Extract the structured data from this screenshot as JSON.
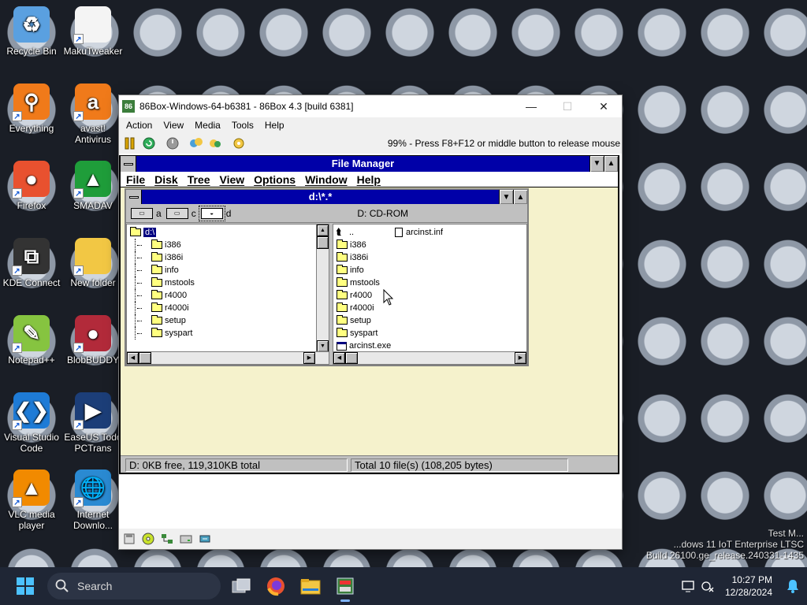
{
  "desktop": {
    "icons": [
      {
        "label": "Recycle Bin",
        "glyph": "♻",
        "color": "#5aa0e0"
      },
      {
        "label": "MakuTweaker",
        "glyph": "",
        "color": "#f4f4f4"
      },
      {
        "label": "Everything",
        "glyph": "⚲",
        "color": "#f07a1a"
      },
      {
        "label": "avast! Antivirus",
        "glyph": "a",
        "color": "#f07a1a"
      },
      {
        "label": "Firefox",
        "glyph": "●",
        "color": "#e8512f"
      },
      {
        "label": "SMADAV",
        "glyph": "▲",
        "color": "#1f9d3a"
      },
      {
        "label": "KDE Connect",
        "glyph": "⧉",
        "color": "#333333"
      },
      {
        "label": "New folder",
        "glyph": "",
        "color": "#f2c744"
      },
      {
        "label": "Notepad++",
        "glyph": "✎",
        "color": "#86c440"
      },
      {
        "label": "BlobBUDDY",
        "glyph": "●",
        "color": "#b22a3a"
      },
      {
        "label": "Visual Studio Code",
        "glyph": "❮❯",
        "color": "#1e7bd6"
      },
      {
        "label": "EaseUS Todo PCTrans",
        "glyph": "▶",
        "color": "#1c3e78"
      },
      {
        "label": "VLC media player",
        "glyph": "▲",
        "color": "#f18a00"
      },
      {
        "label": "Internet Downlo...",
        "glyph": "🌐",
        "color": "#2a8ad2"
      }
    ]
  },
  "emulator": {
    "title": "86Box-Windows-64-b6381 - 86Box 4.3 [build 6381]",
    "app_icon": "86",
    "controls": {
      "minimize": "—",
      "maximize": "☐",
      "close": "✕"
    },
    "menu": [
      "Action",
      "View",
      "Media",
      "Tools",
      "Help"
    ],
    "toolbar_status": "99% - Press F8+F12 or middle button to release mouse"
  },
  "file_manager": {
    "title": "File Manager",
    "menu": [
      "File",
      "Disk",
      "Tree",
      "View",
      "Options",
      "Window",
      "Help"
    ],
    "dir_window": {
      "title": "d:\\*.*",
      "drives": [
        {
          "letter": "a",
          "selected": false
        },
        {
          "letter": "c",
          "selected": false
        },
        {
          "letter": "d",
          "selected": true
        }
      ],
      "volume_label": "D: CD-ROM",
      "tree": {
        "root": "d:\\",
        "children": [
          "i386",
          "i386i",
          "info",
          "mstools",
          "r4000",
          "r4000i",
          "setup",
          "syspart"
        ]
      },
      "files_col1": [
        "..",
        "i386",
        "i386i",
        "info",
        "mstools",
        "r4000",
        "r4000i",
        "setup",
        "syspart",
        "arcinst.exe"
      ],
      "files_col2": [
        "arcinst.inf"
      ]
    },
    "status": {
      "left": "D: 0KB free,  119,310KB total",
      "right": "Total 10 file(s) (108,205 bytes)"
    }
  },
  "taskbar": {
    "search_label": "Search",
    "time": "10:27 PM",
    "date": "12/28/2024"
  },
  "watermark": {
    "line1": "Test M...",
    "line2": "...dows 11 IoT Enterprise LTSC",
    "line3": "Build 26100.ge_release.240331-1435"
  }
}
